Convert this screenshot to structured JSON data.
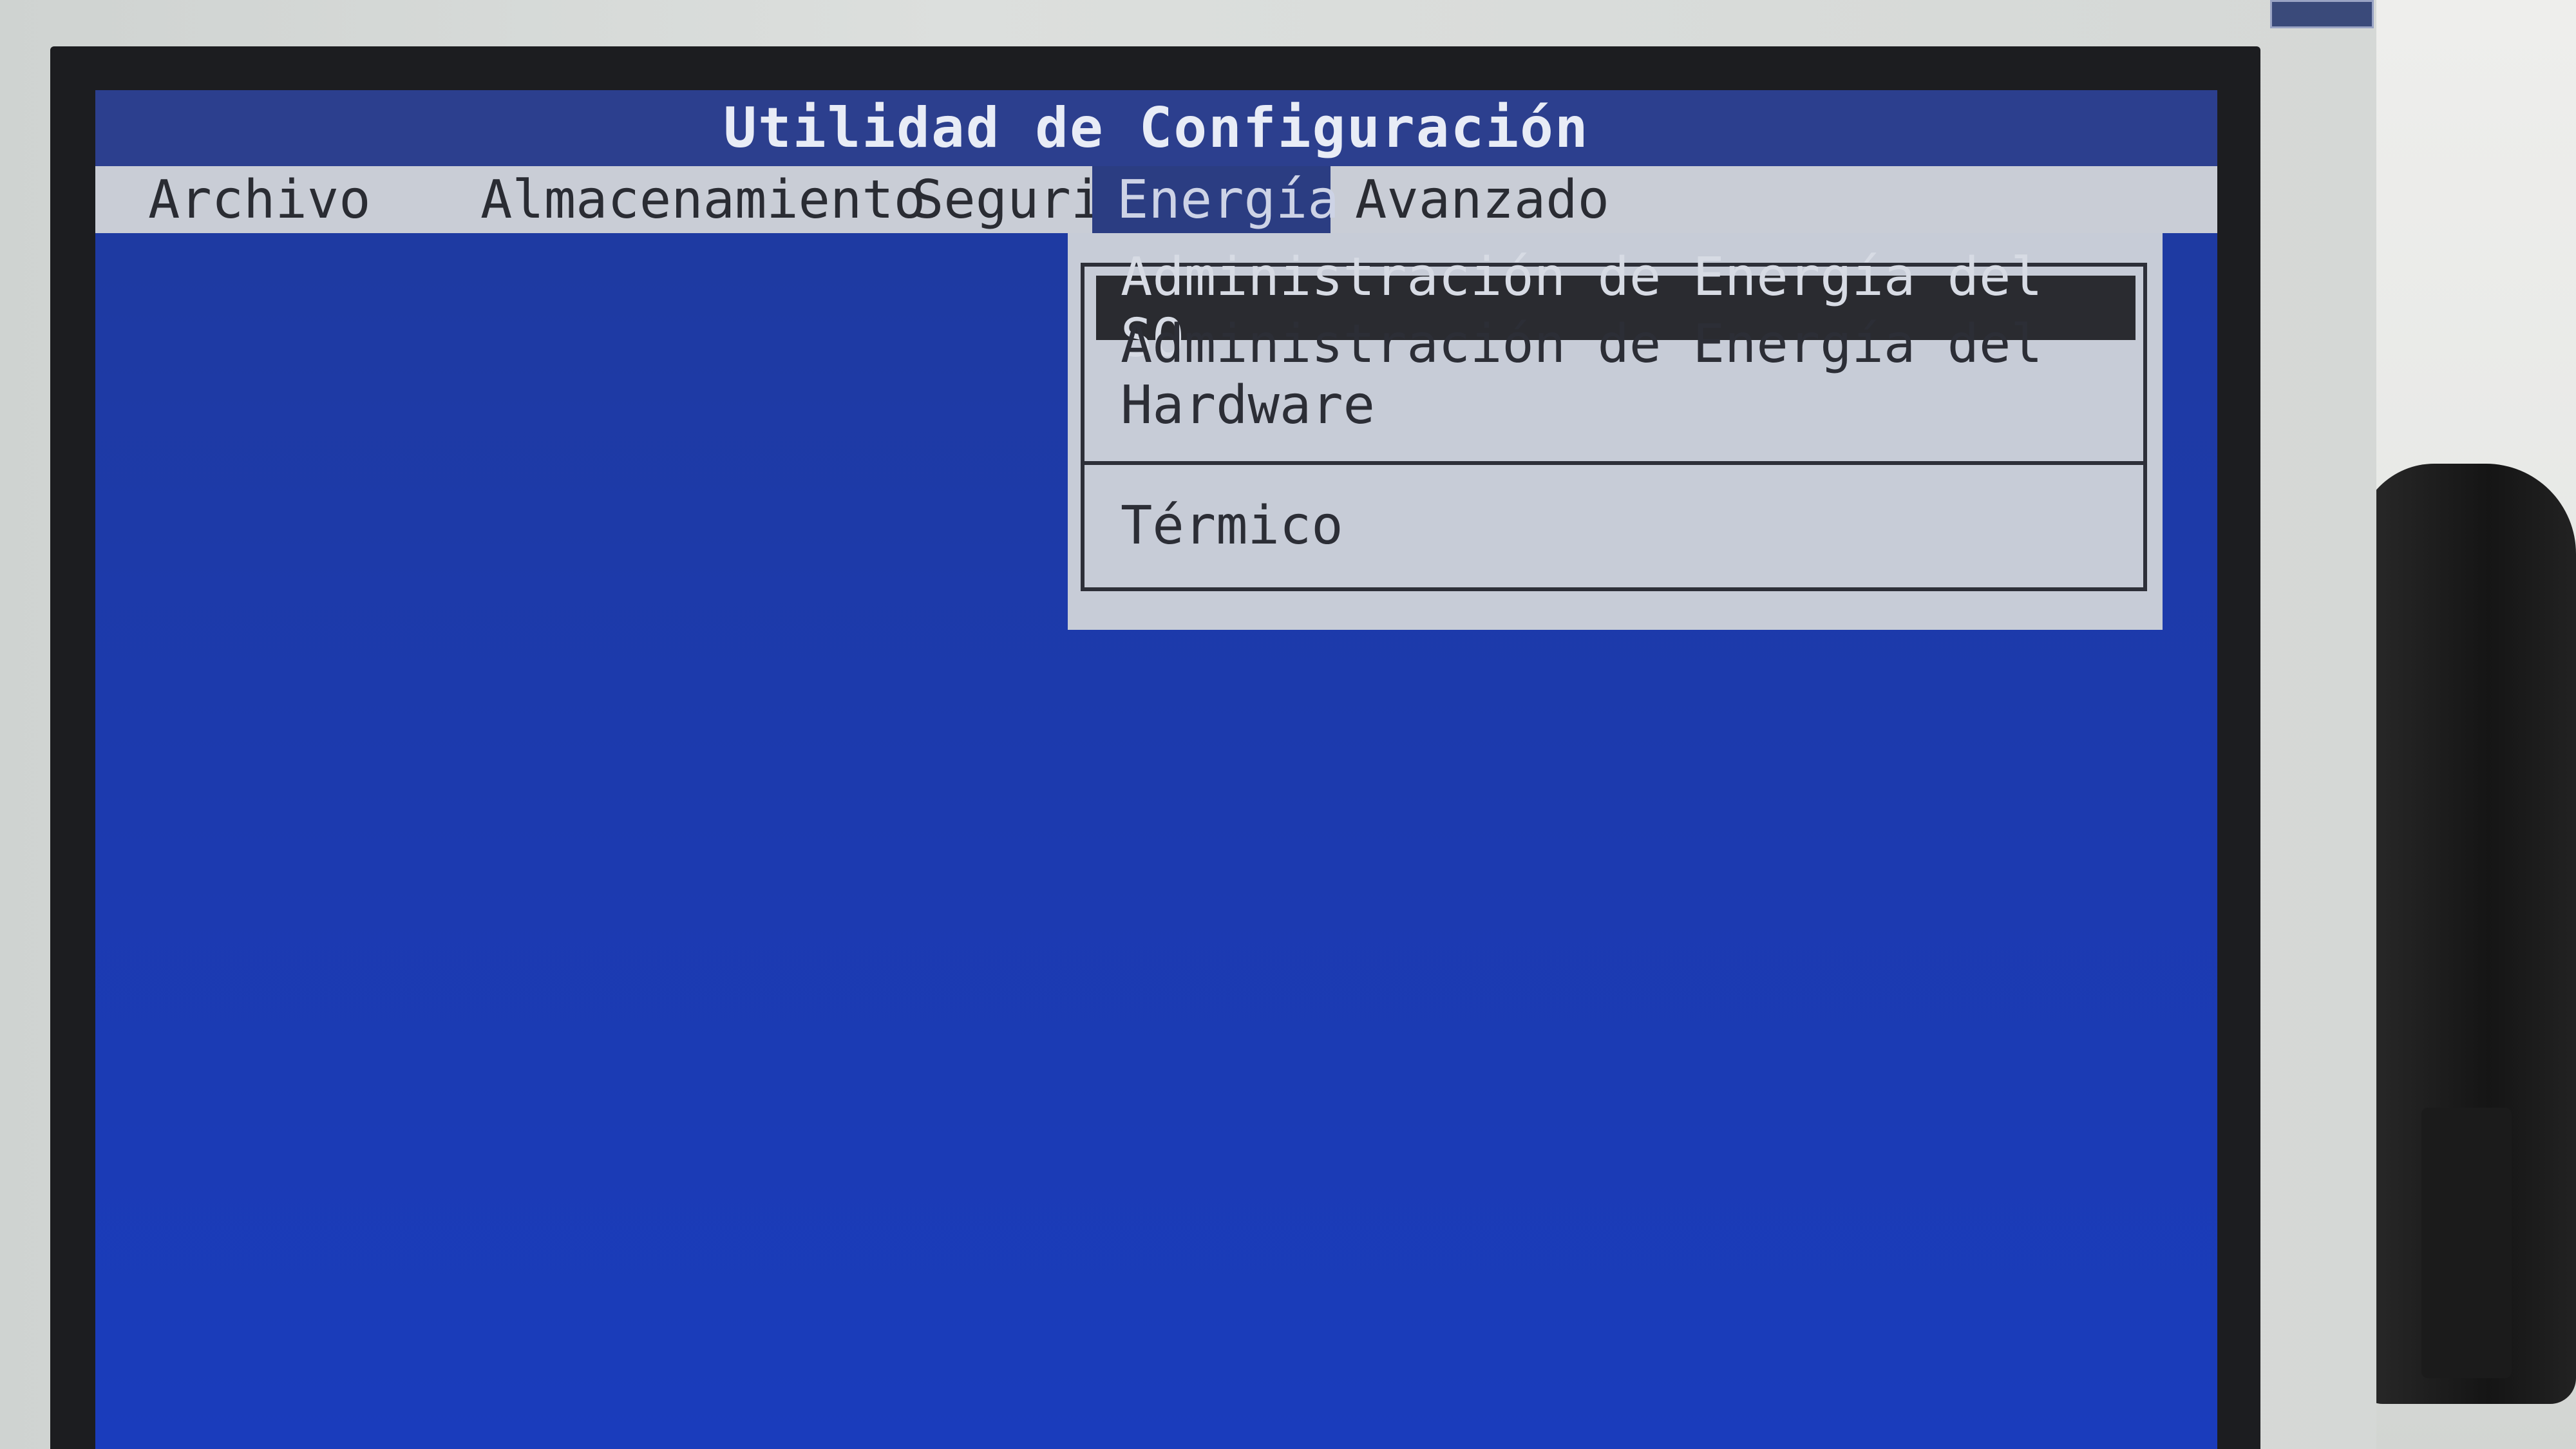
{
  "screen": {
    "title": "Utilidad de Configuración",
    "menu": [
      {
        "label": "Archivo",
        "active": false
      },
      {
        "label": "Almacenamiento",
        "active": false
      },
      {
        "label": "Seguridad",
        "active": false
      },
      {
        "label": "Energía",
        "active": true
      },
      {
        "label": "Avanzado",
        "active": false
      }
    ],
    "dropdown": {
      "items": [
        {
          "label": "Administración de Energía del SO",
          "selected": true
        },
        {
          "label": "Administración de Energía del Hardware",
          "selected": false
        },
        {
          "label": "Térmico",
          "selected": false
        }
      ]
    }
  },
  "colors": {
    "screen_background": "#1c3aae",
    "title_bar": "#2c3f8e",
    "menubar": "#c9cdd6",
    "active_menu": "#2b3d82",
    "dropdown": "#c7ccd7",
    "selected_item": "#2a2b30"
  }
}
